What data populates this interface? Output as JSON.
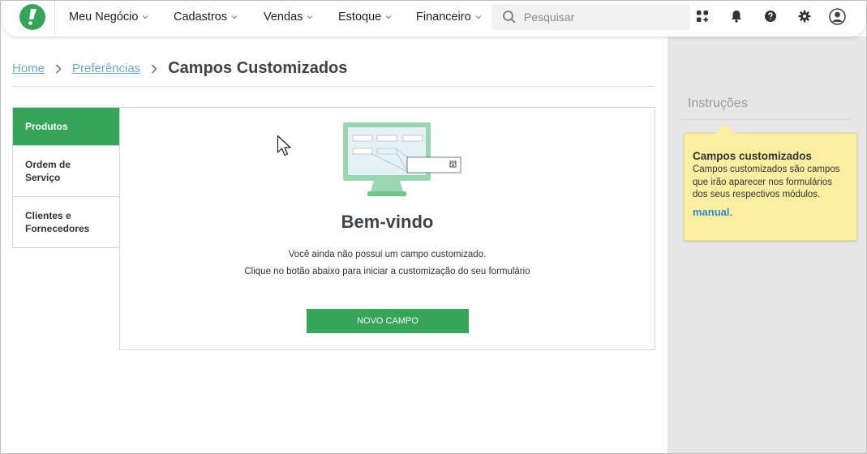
{
  "nav": {
    "items": [
      {
        "label": "Meu Negócio"
      },
      {
        "label": "Cadastros"
      },
      {
        "label": "Vendas"
      },
      {
        "label": "Estoque"
      },
      {
        "label": "Financeiro"
      }
    ],
    "search_placeholder": "Pesquisar",
    "icons": [
      "apps-icon",
      "bell-icon",
      "help-icon",
      "gear-icon",
      "user-avatar-icon"
    ]
  },
  "breadcrumb": {
    "home": "Home",
    "parent": "Preferências",
    "current": "Campos Customizados"
  },
  "tabs": [
    {
      "label": "Produtos",
      "active": true
    },
    {
      "label": "Ordem de Serviço",
      "active": false
    },
    {
      "label": "Clientes e Fornecedores",
      "active": false
    }
  ],
  "main": {
    "welcome": "Bem-vindo",
    "message_line1": "Você ainda não possui um campo customizado.",
    "message_line2": "Clique no botão abaixo para iniciar a customização do seu formulário",
    "button_label": "NOVO CAMPO"
  },
  "instructions": {
    "title": "Instruções",
    "note_title": "Campos customizados",
    "note_text": "Campos customizados são campos que irão aparecer nos formulários dos seus respectivos módulos.",
    "link_label": "manual",
    "link_suffix": "."
  },
  "colors": {
    "brand_green": "#36a55a",
    "link_blue": "#2b8cc4",
    "note_yellow": "#fdeea2"
  }
}
